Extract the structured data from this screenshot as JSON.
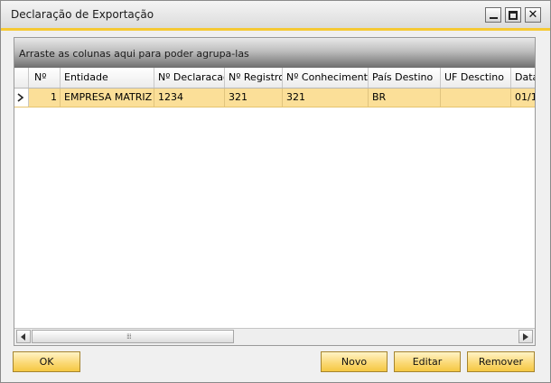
{
  "window": {
    "title": "Declaração de Exportação"
  },
  "grid": {
    "group_panel_text": "Arraste as colunas aqui para poder agrupa-las",
    "columns": [
      "Nº",
      "Entidade",
      "Nº Declaracao",
      "Nº Registro",
      "Nº Conhecimento",
      "País Destino",
      "UF Desctino",
      "Data"
    ],
    "rows": [
      {
        "num": "1",
        "entidade": "EMPRESA MATRIZ",
        "declaracao": "1234",
        "registro": "321",
        "conhecimento": "321",
        "pais_destino": "BR",
        "uf_destino": "",
        "data": "01/1"
      }
    ]
  },
  "buttons": {
    "ok": "OK",
    "novo": "Novo",
    "editar": "Editar",
    "remover": "Remover"
  },
  "icons": {
    "row_selector": "row-pointer-icon",
    "scroll_left": "chevron-left-icon",
    "scroll_right": "chevron-right-icon"
  },
  "colors": {
    "accent": "#f6c934",
    "selected_row": "#fbdf98",
    "button": "#fbd977"
  }
}
